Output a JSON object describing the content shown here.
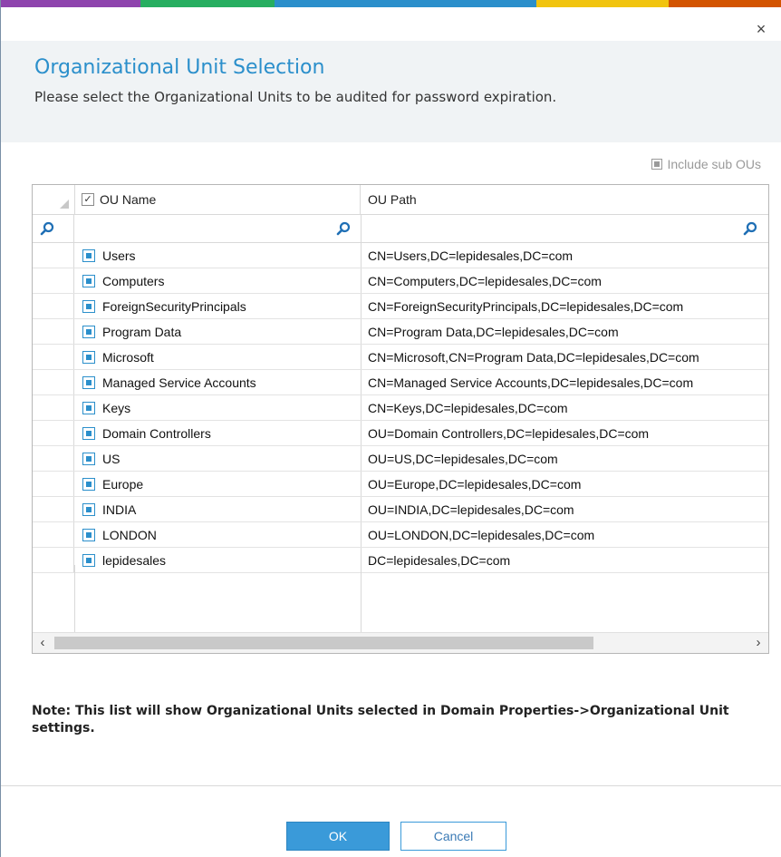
{
  "window": {
    "close_glyph": "×",
    "accent_strip": [
      "#8e44ad",
      "#27ae60",
      "#2b8fcb",
      "#2b8fcb",
      "#f1c40f",
      "#e67e22",
      "#95a5a6"
    ]
  },
  "header": {
    "title": "Organizational Unit Selection",
    "subtitle": "Please select the Organizational Units to be audited for password expiration."
  },
  "options": {
    "include_sub_ous_label": "Include sub OUs"
  },
  "grid": {
    "columns": {
      "name": "OU Name",
      "path": "OU Path"
    },
    "header_check_glyph": "✓",
    "rows": [
      {
        "name": "Users",
        "path": "CN=Users,DC=lepidesales,DC=com"
      },
      {
        "name": "Computers",
        "path": "CN=Computers,DC=lepidesales,DC=com"
      },
      {
        "name": "ForeignSecurityPrincipals",
        "path": "CN=ForeignSecurityPrincipals,DC=lepidesales,DC=com"
      },
      {
        "name": "Program Data",
        "path": "CN=Program Data,DC=lepidesales,DC=com"
      },
      {
        "name": "Microsoft",
        "path": "CN=Microsoft,CN=Program Data,DC=lepidesales,DC=com"
      },
      {
        "name": "Managed Service Accounts",
        "path": "CN=Managed Service Accounts,DC=lepidesales,DC=com"
      },
      {
        "name": "Keys",
        "path": "CN=Keys,DC=lepidesales,DC=com"
      },
      {
        "name": "Domain Controllers",
        "path": "OU=Domain Controllers,DC=lepidesales,DC=com"
      },
      {
        "name": "US",
        "path": "OU=US,DC=lepidesales,DC=com"
      },
      {
        "name": "Europe",
        "path": "OU=Europe,DC=lepidesales,DC=com"
      },
      {
        "name": "INDIA",
        "path": "OU=INDIA,DC=lepidesales,DC=com"
      },
      {
        "name": "LONDON",
        "path": "OU=LONDON,DC=lepidesales,DC=com"
      },
      {
        "name": "lepidesales",
        "path": "DC=lepidesales,DC=com"
      }
    ],
    "scroll_left_glyph": "‹",
    "scroll_right_glyph": "›"
  },
  "note": "Note: This list will show Organizational Units selected in Domain Properties->Organizational Unit settings.",
  "buttons": {
    "ok": "OK",
    "cancel": "Cancel"
  },
  "colors": {
    "accent": "#2b8fcb",
    "ok_button": "#3a9ad9"
  }
}
